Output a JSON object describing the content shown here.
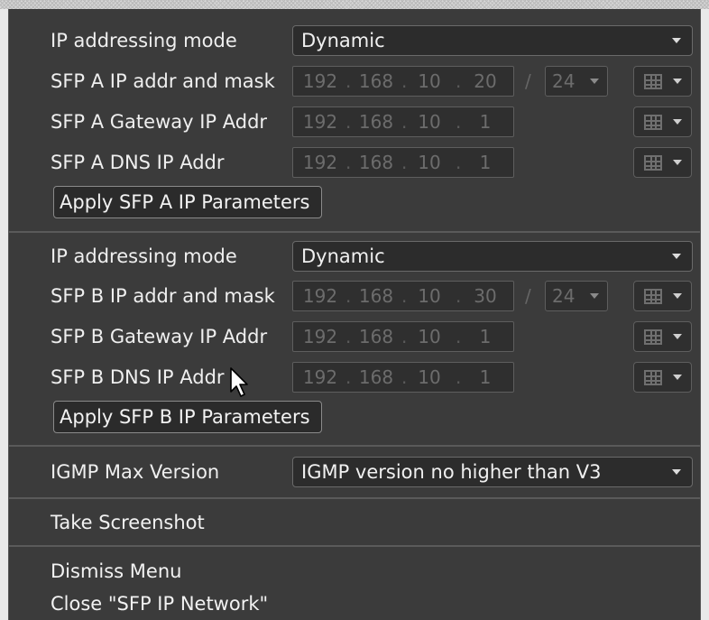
{
  "sfp_a": {
    "mode_label": "IP addressing mode",
    "mode_value": "Dynamic",
    "ip_label": "SFP A IP addr and mask",
    "ip": [
      "192",
      "168",
      "10",
      "20"
    ],
    "mask": "24",
    "gateway_label": "SFP A Gateway IP Addr",
    "gateway": [
      "192",
      "168",
      "10",
      "1"
    ],
    "dns_label": "SFP A DNS IP Addr",
    "dns": [
      "192",
      "168",
      "10",
      "1"
    ],
    "apply_label": "Apply SFP A IP Parameters"
  },
  "sfp_b": {
    "mode_label": "IP addressing mode",
    "mode_value": "Dynamic",
    "ip_label": "SFP B IP addr and mask",
    "ip": [
      "192",
      "168",
      "10",
      "30"
    ],
    "mask": "24",
    "gateway_label": "SFP B Gateway IP Addr",
    "gateway": [
      "192",
      "168",
      "10",
      "1"
    ],
    "dns_label": "SFP B DNS IP Addr",
    "dns": [
      "192",
      "168",
      "10",
      "1"
    ],
    "apply_label": "Apply SFP B IP Parameters"
  },
  "igmp": {
    "label": "IGMP Max Version",
    "value": "IGMP version no higher than V3"
  },
  "menu": {
    "take_screenshot": "Take Screenshot",
    "dismiss": "Dismiss Menu",
    "close": "Close \"SFP IP Network\""
  },
  "separators": {
    "dot": ".",
    "slash": "/"
  },
  "icons": {
    "dropdown_caret": "caret-down",
    "picker": "grid-icon",
    "pointer": "mouse-pointer"
  }
}
